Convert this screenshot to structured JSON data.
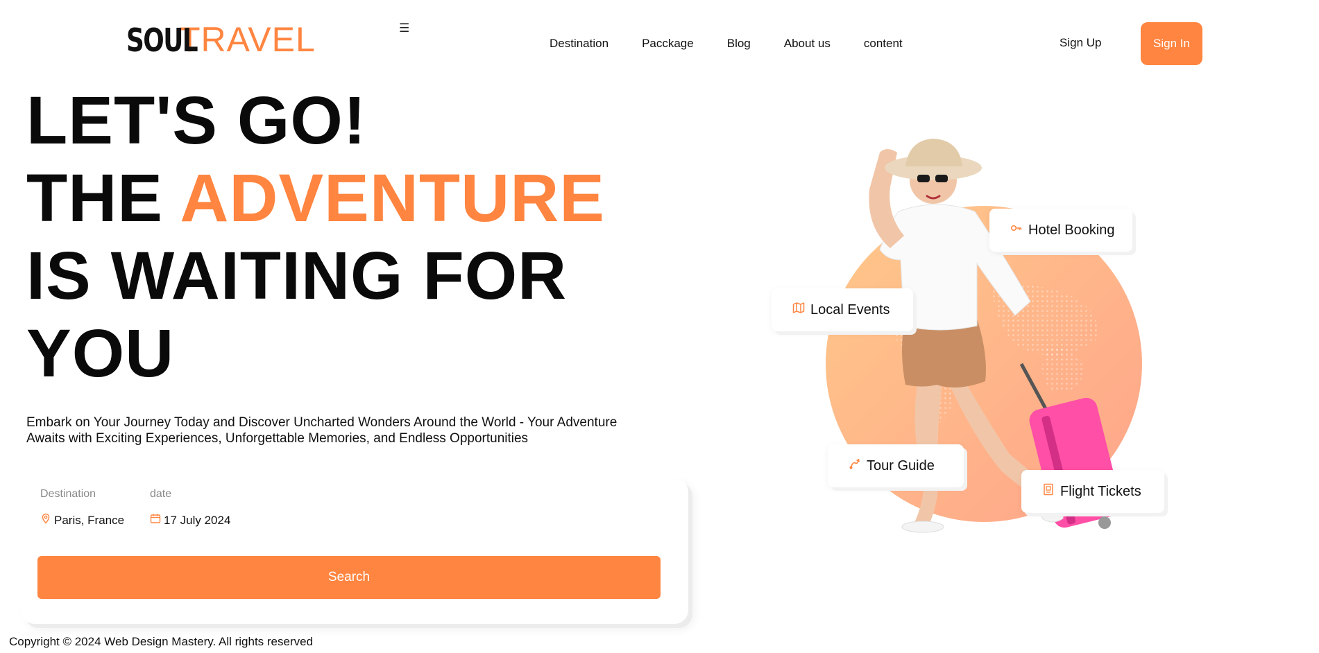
{
  "header": {
    "logo": {
      "part1": "SOUL",
      "part2": "TRAVEL"
    },
    "menu_icon": "☰",
    "nav": [
      "Destination",
      "Pacckage",
      "Blog",
      "About us",
      "content"
    ],
    "signup_label": "Sign Up",
    "signin_label": "Sign In"
  },
  "hero": {
    "line1": "LET'S GO!",
    "line2_prefix": "THE ",
    "line2_accent": "ADVENTURE",
    "line3": "IS WAITING FOR",
    "line4": "YOU",
    "description": "Embark on Your Journey Today and Discover Uncharted Wonders Around the World - Your Adventure Awaits with Exciting Experiences, Unforgettable Memories, and Endless Opportunities"
  },
  "search": {
    "destination_label": "Destination",
    "destination_value": "Paris, France",
    "date_label": "date",
    "date_value": "17 July 2024",
    "button_label": "Search"
  },
  "features": {
    "hotel": {
      "label": "Hotel Booking",
      "icon": "key-icon"
    },
    "events": {
      "label": "Local Events",
      "icon": "map-icon"
    },
    "guide": {
      "label": "Tour Guide",
      "icon": "route-icon"
    },
    "flight": {
      "label": "Flight Tickets",
      "icon": "ticket-icon"
    }
  },
  "footer": {
    "copyright": "Copyright © 2024 Web Design Mastery. All rights reserved"
  },
  "colors": {
    "accent": "#ff8540",
    "text": "#111111",
    "muted": "#8a8a8a"
  }
}
